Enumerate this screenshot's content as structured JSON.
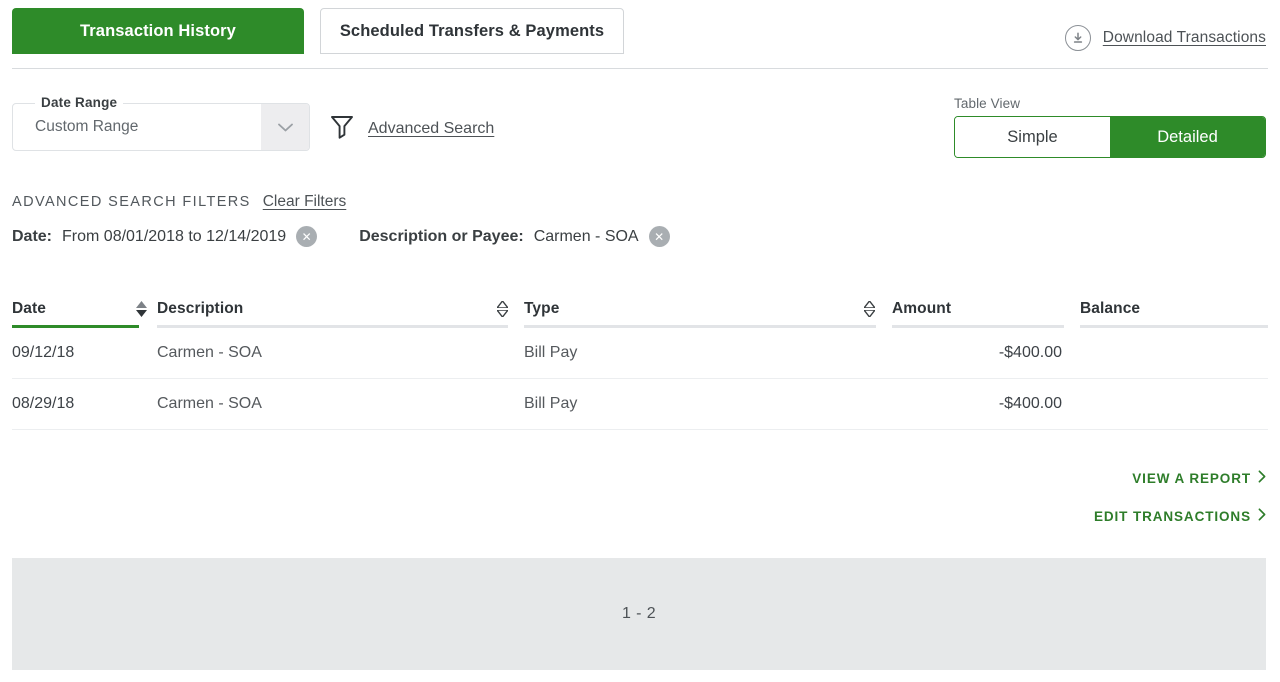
{
  "tabs": [
    {
      "label": "Transaction History",
      "active": true
    },
    {
      "label": "Scheduled Transfers & Payments",
      "active": false
    }
  ],
  "header": {
    "download_label": "Download Transactions",
    "download_icon": "download-circle-icon"
  },
  "controls": {
    "date_range": {
      "legend": "Date Range",
      "value": "Custom Range",
      "chevron_icon": "chevron-down-icon"
    },
    "advanced_search": {
      "label": "Advanced Search",
      "icon": "filter-funnel-icon"
    },
    "table_view": {
      "label": "Table View",
      "options": [
        "Simple",
        "Detailed"
      ],
      "selected": "Detailed"
    }
  },
  "filters": {
    "title": "ADVANCED SEARCH FILTERS",
    "clear_label": "Clear Filters",
    "chips": [
      {
        "key": "Date:",
        "value": "From 08/01/2018 to 12/14/2019",
        "remove_icon": "x-icon"
      },
      {
        "key": "Description or Payee:",
        "value": "Carmen - SOA",
        "remove_icon": "x-icon"
      }
    ]
  },
  "table": {
    "columns": [
      {
        "label": "Date",
        "sortable": true,
        "sorted": true,
        "sort_dir": "desc"
      },
      {
        "label": "Description",
        "sortable": true,
        "sorted": false
      },
      {
        "label": "Type",
        "sortable": true,
        "sorted": false
      },
      {
        "label": "Amount",
        "sortable": false,
        "sorted": false
      },
      {
        "label": "Balance",
        "sortable": false,
        "sorted": false
      }
    ],
    "rows": [
      {
        "date": "09/12/18",
        "description": "Carmen - SOA",
        "type": "Bill Pay",
        "amount": "-$400.00",
        "balance": ""
      },
      {
        "date": "08/29/18",
        "description": "Carmen - SOA",
        "type": "Bill Pay",
        "amount": "-$400.00",
        "balance": ""
      }
    ]
  },
  "actions": [
    {
      "label": "VIEW A REPORT",
      "icon": "chevron-right-icon"
    },
    {
      "label": "EDIT TRANSACTIONS",
      "icon": "chevron-right-icon"
    }
  ],
  "pager": {
    "range_label": "1 - 2"
  },
  "colors": {
    "brand_green": "#2E8B29",
    "link_green": "#2E7D2A",
    "footer_gray": "#e6e8e9",
    "text": "#3a3f42"
  }
}
